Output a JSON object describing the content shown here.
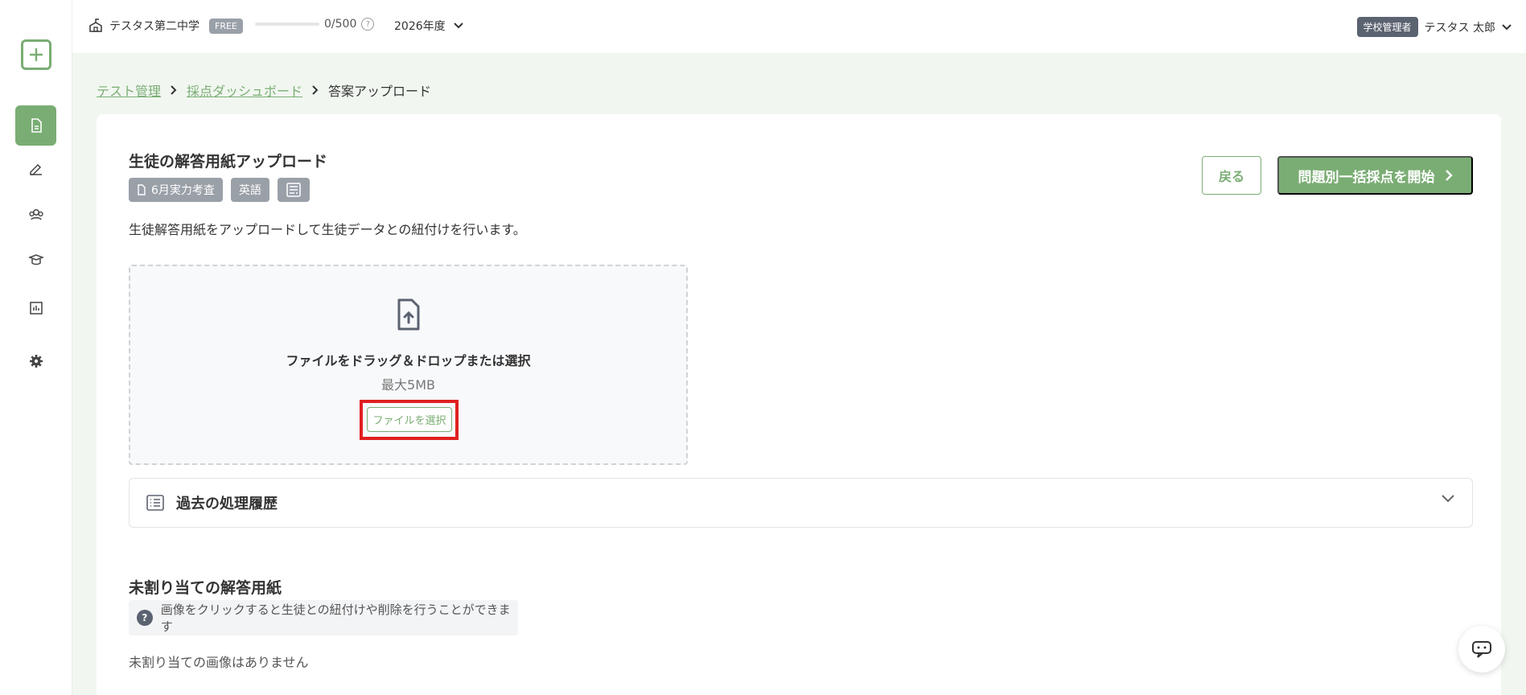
{
  "header": {
    "school_name": "テスタス第二中学",
    "plan_badge": "FREE",
    "quota_text": "0/500",
    "quota_progress": 0,
    "year_label": "2026年度",
    "role_badge": "学校管理者",
    "user_name": "テスタス 太郎"
  },
  "sidebar": {
    "items": [
      {
        "name": "create",
        "icon": "plus-icon"
      },
      {
        "name": "tests",
        "icon": "document-icon",
        "active": true
      },
      {
        "name": "grading",
        "icon": "pen-icon"
      },
      {
        "name": "students",
        "icon": "group-icon"
      },
      {
        "name": "teachers",
        "icon": "teacher-icon"
      },
      {
        "name": "reports",
        "icon": "chart-icon"
      },
      {
        "name": "settings",
        "icon": "gear-icon"
      }
    ]
  },
  "breadcrumb": {
    "items": [
      "テスト管理",
      "採点ダッシュボード",
      "答案アップロード"
    ]
  },
  "page": {
    "title": "生徒の解答用紙アップロード",
    "tags": [
      "6月実力考査",
      "英語"
    ],
    "description": "生徒解答用紙をアップロードして生徒データとの紐付けを行います。",
    "back_button": "戻る",
    "start_button": "問題別一括採点を開始"
  },
  "dropzone": {
    "title": "ファイルをドラッグ＆ドロップまたは選択",
    "subtitle": "最大5MB",
    "button_label": "ファイルを選択"
  },
  "history": {
    "label": "過去の処理履歴"
  },
  "unassigned": {
    "title": "未割り当ての解答用紙",
    "note": "画像をクリックすると生徒との紐付けや削除を行うことができます",
    "empty_text": "未割り当ての画像はありません"
  },
  "colors": {
    "accent": "#7aad74",
    "highlight": "#e02020",
    "content_bg": "#f1f7f0"
  }
}
